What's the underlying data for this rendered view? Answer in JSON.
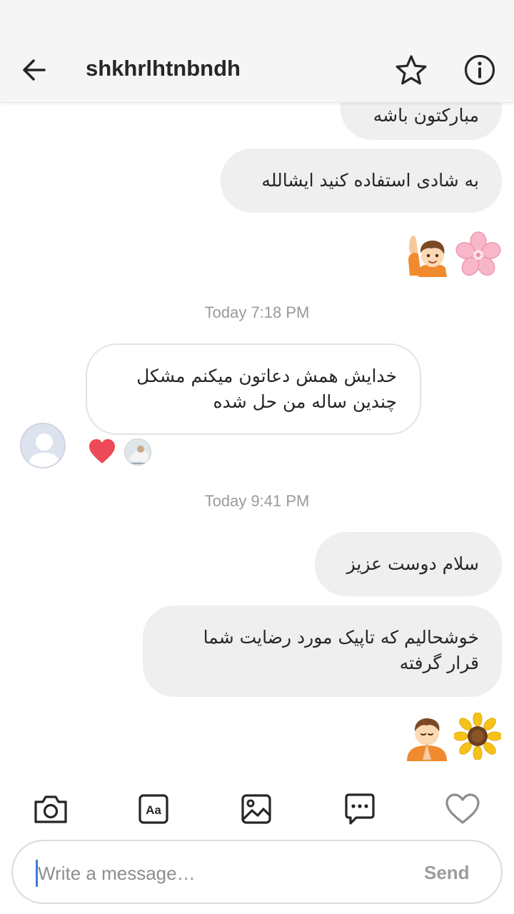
{
  "header": {
    "title": "shkhrlhtnbndh",
    "back_icon": "arrow-left-icon",
    "star_icon": "star-outline-icon",
    "info_icon": "info-circle-icon"
  },
  "thread": {
    "messages_top": [
      {
        "direction": "out",
        "text": "مبارکتون باشه"
      },
      {
        "direction": "out",
        "text": "به شادی استفاده کنید ایشالله"
      }
    ],
    "emojis_1": [
      "raising-hand-boy-emoji",
      "pink-flower-emoji"
    ],
    "timestamp_1": "Today 7:18 PM",
    "incoming": {
      "line1": "خدایش همش دعاتون میکنم مشکل",
      "line2": "چندین ساله من حل شده"
    },
    "reaction_icon": "red-heart-icon",
    "timestamp_2": "Today 9:41 PM",
    "messages_bottom": [
      {
        "direction": "out",
        "text": "سلام دوست عزیز"
      },
      {
        "direction": "out",
        "line1": "خوشحالیم که تاپیک مورد رضایت شما",
        "line2": "قرار گرفته"
      }
    ],
    "emojis_2": [
      "praying-boy-emoji",
      "sunflower-emoji"
    ]
  },
  "toolbar": {
    "icons": [
      "camera-icon",
      "text-style-icon",
      "gallery-icon",
      "chat-bubble-icon",
      "heart-outline-icon"
    ]
  },
  "composer": {
    "placeholder": "Write a message…",
    "send_label": "Send"
  },
  "colors": {
    "bubble_out": "#efefef",
    "heart": "#ed4956",
    "timestamp": "#9a9a9a"
  }
}
